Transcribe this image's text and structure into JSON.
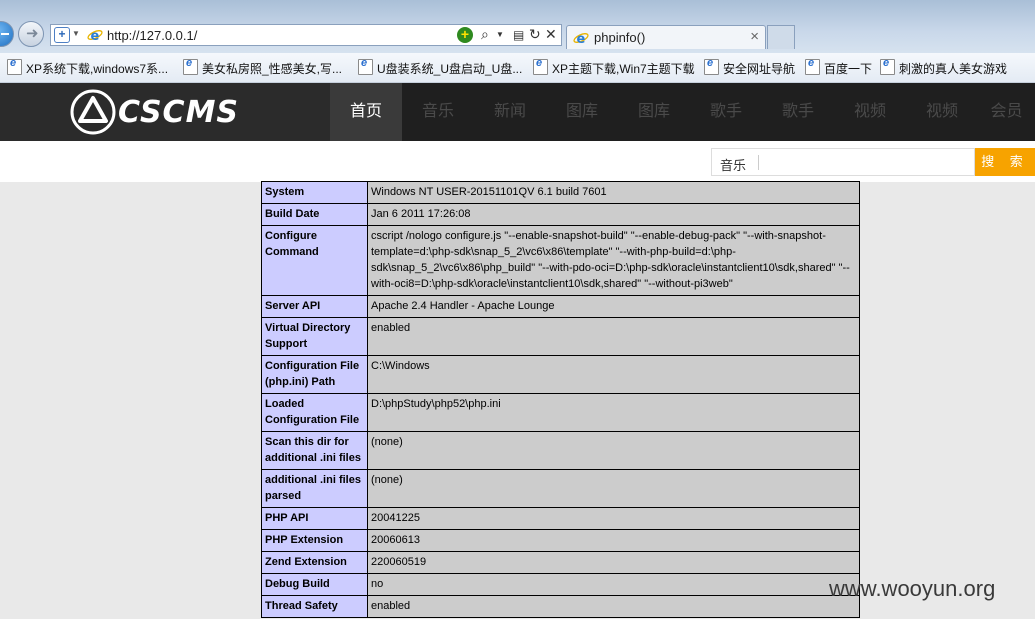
{
  "browser": {
    "url": "http://127.0.0.1/",
    "tab_title": "phpinfo()",
    "favorites": [
      "XP系统下载,windows7系...",
      "美女私房照_性感美女,写...",
      "U盘装系统_U盘启动_U盘...",
      "XP主题下载,Win7主题下载",
      "安全网址导航",
      "百度一下",
      "刺激的真人美女游戏"
    ]
  },
  "site": {
    "logo_text": "CSCMS",
    "nav": [
      "首页",
      "音乐",
      "新闻",
      "图库",
      "图库",
      "歌手",
      "歌手",
      "视频",
      "视频",
      "会员"
    ],
    "search": {
      "category": "音乐",
      "button": "搜 索"
    }
  },
  "phpinfo": {
    "rows": [
      {
        "key": "System",
        "value": "Windows NT USER-20151101QV 6.1 build 7601"
      },
      {
        "key": "Build Date",
        "value": "Jan 6 2011 17:26:08"
      },
      {
        "key": "Configure Command",
        "value": "cscript /nologo configure.js \"--enable-snapshot-build\" \"--enable-debug-pack\" \"--with-snapshot-template=d:\\php-sdk\\snap_5_2\\vc6\\x86\\template\" \"--with-php-build=d:\\php-sdk\\snap_5_2\\vc6\\x86\\php_build\" \"--with-pdo-oci=D:\\php-sdk\\oracle\\instantclient10\\sdk,shared\" \"--with-oci8=D:\\php-sdk\\oracle\\instantclient10\\sdk,shared\" \"--without-pi3web\""
      },
      {
        "key": "Server API",
        "value": "Apache 2.4 Handler - Apache Lounge"
      },
      {
        "key": "Virtual Directory Support",
        "value": "enabled"
      },
      {
        "key": "Configuration File (php.ini) Path",
        "value": "C:\\Windows"
      },
      {
        "key": "Loaded Configuration File",
        "value": "D:\\phpStudy\\php52\\php.ini"
      },
      {
        "key": "Scan this dir for additional .ini files",
        "value": "(none)"
      },
      {
        "key": "additional .ini files parsed",
        "value": "(none)"
      },
      {
        "key": "PHP API",
        "value": "20041225"
      },
      {
        "key": "PHP Extension",
        "value": "20060613"
      },
      {
        "key": "Zend Extension",
        "value": "220060519"
      },
      {
        "key": "Debug Build",
        "value": "no"
      },
      {
        "key": "Thread Safety",
        "value": "enabled"
      }
    ]
  },
  "watermark": "www.wooyun.org"
}
